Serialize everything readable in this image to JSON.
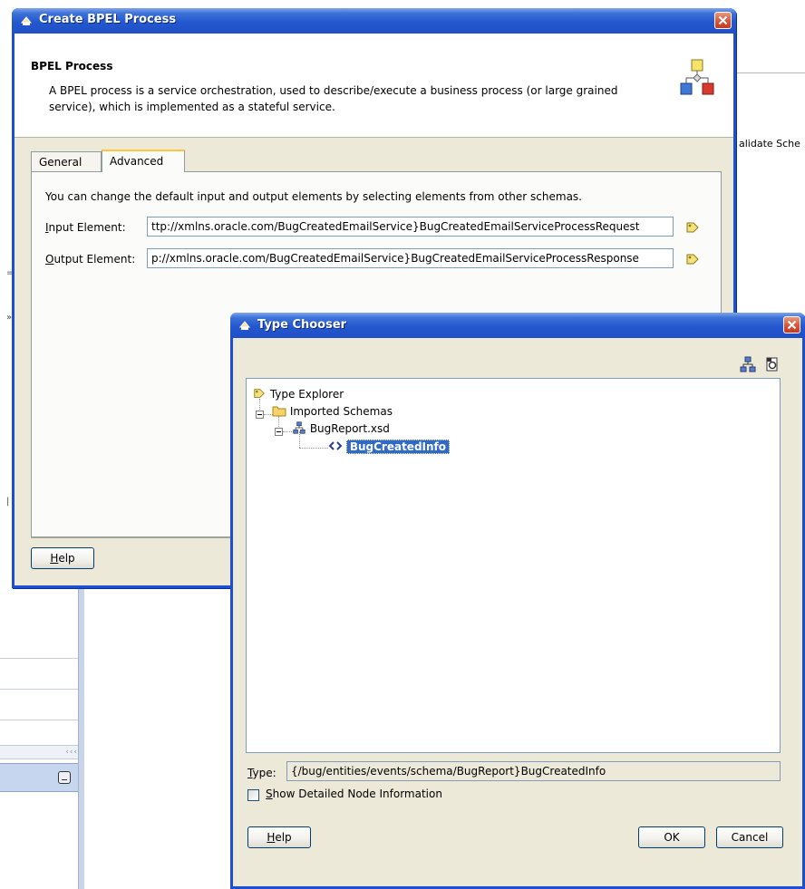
{
  "background": {
    "validate_fragment": "alidate Sche",
    "scroll_arrows": "‹‹‹",
    "edge_marks": [
      "=",
      "»",
      "|"
    ]
  },
  "bpel_dialog": {
    "title": "Create BPEL Process",
    "header_title": "BPEL Process",
    "header_description": "A BPEL process is a service orchestration, used to describe/execute a business process (or large grained service), which is implemented as a stateful service.",
    "tabs": [
      {
        "label": "General",
        "active": false
      },
      {
        "label": "Advanced",
        "active": true
      }
    ],
    "advanced": {
      "intro": "You can change the default input and output elements by selecting elements from other schemas.",
      "input_label_first": "I",
      "input_label_rest": "nput Element:",
      "input_value": "ttp://xmlns.oracle.com/BugCreatedEmailService}BugCreatedEmailServiceProcessRequest",
      "output_label_first": "O",
      "output_label_rest": "utput Element:",
      "output_value": "p://xmlns.oracle.com/BugCreatedEmailService}BugCreatedEmailServiceProcessResponse"
    },
    "help_first": "H",
    "help_rest": "elp"
  },
  "type_chooser": {
    "title": "Type Chooser",
    "tree": {
      "root": "Type Explorer",
      "imported": "Imported Schemas",
      "schema_file": "BugReport.xsd",
      "selected_element": "BugCreatedInfo"
    },
    "type_label_first": "T",
    "type_label_rest": "ype:",
    "type_value": "{/bug/entities/events/schema/BugReport}BugCreatedInfo",
    "checkbox_first": "S",
    "checkbox_rest": "how Detailed Node Information",
    "checkbox_checked": false,
    "help_first": "H",
    "help_rest": "elp",
    "ok_label": "OK",
    "cancel_label": "Cancel"
  },
  "colors": {
    "titlebar": "#2457cf",
    "dialog_face": "#ece9d8",
    "selection": "#316ac5",
    "close_button": "#d8543a"
  },
  "icons": [
    "bpel-process-icon",
    "browse-icon",
    "type-explorer-icon",
    "folder-icon",
    "schema-icon",
    "element-icon",
    "hierarchy-view-icon",
    "schema-browse-icon",
    "close-icon"
  ]
}
